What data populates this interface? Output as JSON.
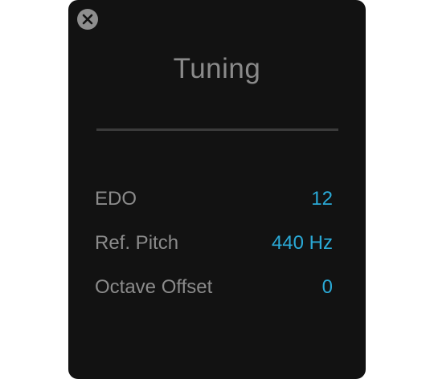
{
  "dialog": {
    "title": "Tuning",
    "close_icon": "close-icon"
  },
  "settings": [
    {
      "label": "EDO",
      "value": "12"
    },
    {
      "label": "Ref. Pitch",
      "value": "440 Hz"
    },
    {
      "label": "Octave Offset",
      "value": "0"
    }
  ],
  "colors": {
    "background": "#121212",
    "label": "#8b8b8b",
    "value_accent": "#2aa9d6",
    "close_button": "#8e8e8e"
  }
}
